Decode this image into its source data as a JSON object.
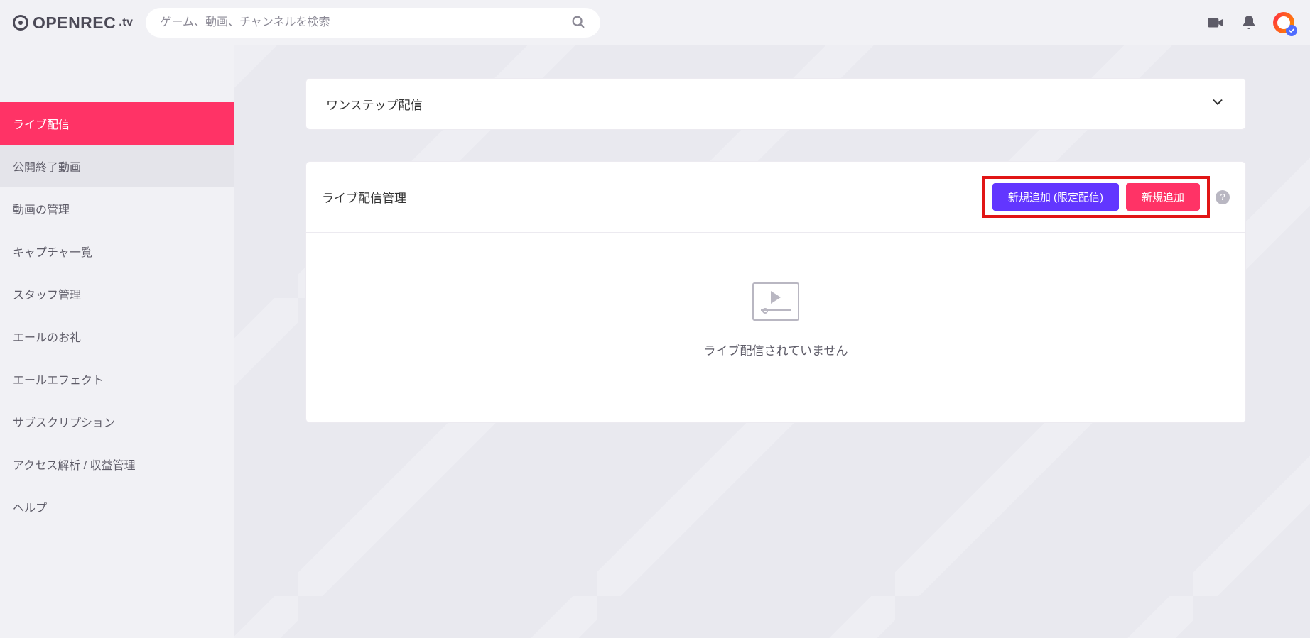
{
  "brand": {
    "name": "OPENREC",
    "tld": ".tv"
  },
  "search": {
    "placeholder": "ゲーム、動画、チャンネルを検索"
  },
  "header_icons": {
    "camera": "camera-icon",
    "bell": "bell-icon",
    "avatar": "avatar"
  },
  "sidebar": {
    "items": [
      {
        "label": "ライブ配信",
        "slug": "live-broadcast",
        "active": true,
        "highlight": false
      },
      {
        "label": "公開終了動画",
        "slug": "ended-videos",
        "active": false,
        "highlight": true
      },
      {
        "label": "動画の管理",
        "slug": "video-management",
        "active": false,
        "highlight": false
      },
      {
        "label": "キャプチャ一覧",
        "slug": "captures",
        "active": false,
        "highlight": false
      },
      {
        "label": "スタッフ管理",
        "slug": "staff",
        "active": false,
        "highlight": false
      },
      {
        "label": "エールのお礼",
        "slug": "yell-thanks",
        "active": false,
        "highlight": false
      },
      {
        "label": "エールエフェクト",
        "slug": "yell-effect",
        "active": false,
        "highlight": false
      },
      {
        "label": "サブスクリプション",
        "slug": "subscription",
        "active": false,
        "highlight": false
      },
      {
        "label": "アクセス解析 / 収益管理",
        "slug": "analytics-revenue",
        "active": false,
        "highlight": false
      },
      {
        "label": "ヘルプ",
        "slug": "help",
        "active": false,
        "highlight": false
      }
    ]
  },
  "cards": {
    "onestep": {
      "title": "ワンステップ配信"
    },
    "live_manage": {
      "title": "ライブ配信管理",
      "add_limited_label": "新規追加 (限定配信)",
      "add_label": "新規追加",
      "empty_text": "ライブ配信されていません"
    }
  },
  "colors": {
    "accent_red": "#ff3366",
    "accent_blue": "#6236ff",
    "highlight_box": "#e11515"
  }
}
